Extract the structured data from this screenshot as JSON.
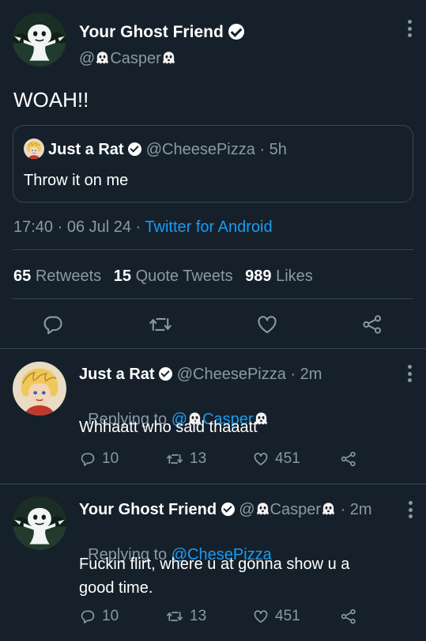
{
  "main_tweet": {
    "display_name": "Your Ghost Friend",
    "handle_prefix": "@",
    "handle_name": "Casper",
    "text": "WOAH!!",
    "quoted": {
      "display_name": "Just a Rat",
      "handle": "@CheesePizza",
      "separator": "·",
      "time": "5h",
      "text": "Throw it on me"
    },
    "timestamp": "17:40 · 06 Jul 24 · ",
    "client": "Twitter for Android",
    "stats": {
      "retweets_count": "65",
      "retweets_label": "Retweets",
      "quotes_count": "15",
      "quotes_label": "Quote Tweets",
      "likes_count": "989",
      "likes_label": "Likes"
    }
  },
  "replies": [
    {
      "display_name": "Just a Rat",
      "handle": "@CheesePizza",
      "separator": "·",
      "time": "2m",
      "replying_label": "Replying to ",
      "replying_prefix": "@",
      "replying_name": "Casper",
      "text": "Whhaatt who said thaaatt",
      "reply_count": "10",
      "retweet_count": "13",
      "like_count": "451"
    },
    {
      "display_name": "Your Ghost Friend",
      "handle_prefix": "@",
      "handle_name": "Casper",
      "separator": "·",
      "time": "2m",
      "replying_label": "Replying to ",
      "replying_handle": "@ChesePizza",
      "text_line1": "Fuckin flirt, where u at gonna show u a",
      "text_line2": "good time.",
      "reply_count": "10",
      "retweet_count": "13",
      "like_count": "451"
    }
  ],
  "colors": {
    "background": "#15202b",
    "text": "#ffffff",
    "muted": "#8b98a5",
    "accent": "#1d9bf0",
    "divider": "#38444d"
  }
}
